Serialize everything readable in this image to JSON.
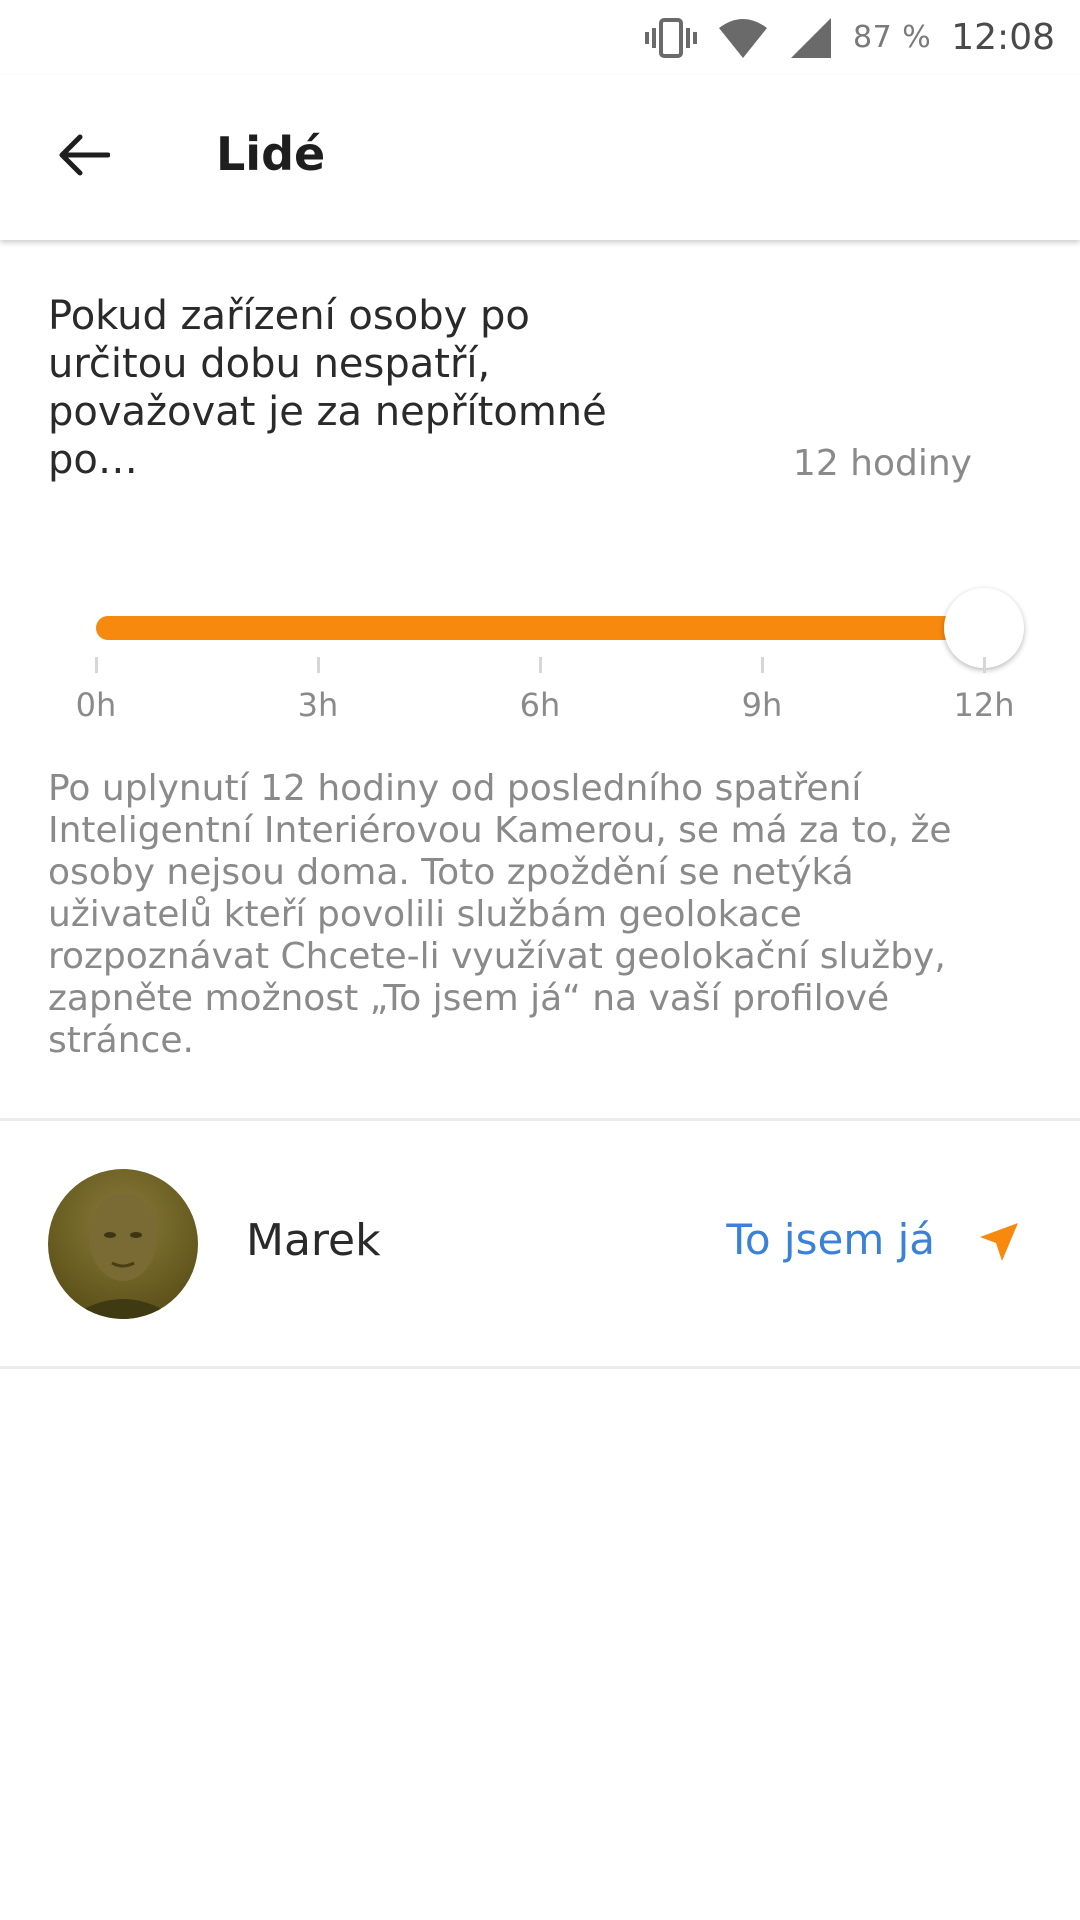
{
  "status_bar": {
    "battery": "87 %",
    "time": "12:08",
    "icons": [
      "vibrate-icon",
      "wifi-icon",
      "signal-icon"
    ]
  },
  "app_bar": {
    "title": "Lidé",
    "back_icon": "arrow-left-icon"
  },
  "absence_setting": {
    "heading": "Pokud zařízení osoby po určitou dobu nespatří, považovat je za nepřítomné po…",
    "value_label": "12 hodiny",
    "slider": {
      "value_hours": 12,
      "min_hours": 0,
      "max_hours": 12,
      "fill_color": "#f7890f",
      "ticks": [
        "0h",
        "3h",
        "6h",
        "9h",
        "12h"
      ]
    },
    "description": "Po uplynutí 12 hodiny od posledního spatření Inteligentní Interiérovou Kamerou, se má za to, že osoby nejsou doma. Toto zpoždění se netýká uživatelů kteří povolili službám geolokace rozpoznávat Chcete-li využívat geolokační služby, zapněte možnost „To jsem já“ na vaší profilové stránce."
  },
  "people": [
    {
      "name": "Marek",
      "action_label": "To jsem já",
      "action_color": "#3b82d6",
      "icon": "location-arrow-icon",
      "icon_color": "#f7890f"
    }
  ]
}
